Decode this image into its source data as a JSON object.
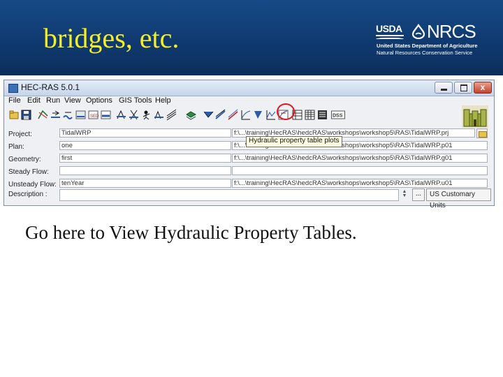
{
  "slide": {
    "title": "bridges, etc.",
    "caption": "Go here to View Hydraulic Property Tables."
  },
  "logo": {
    "usda": "USDA",
    "nrcs": "NRCS",
    "line1": "United States Department of Agriculture",
    "line2": "Natural Resources Conservation Service"
  },
  "window": {
    "title": "HEC-RAS 5.0.1",
    "close_glyph": "x"
  },
  "menu": [
    "File",
    "Edit",
    "Run",
    "View",
    "Options",
    "GIS Tools",
    "Help"
  ],
  "tooltip": "Hydraulic property table plots",
  "rows": {
    "project": {
      "label": "Project:",
      "name": "TidalWRP",
      "path": "f:\\...\\training\\HecRAS\\hedcRAS\\workshops\\workshop5\\RAS\\TidalWRP.prj"
    },
    "plan": {
      "label": "Plan:",
      "name": "one",
      "path": "f:\\...\\training\\HecRAS\\hedcRAS\\workshops\\workshop5\\RAS\\TidalWRP.p01"
    },
    "geometry": {
      "label": "Geometry:",
      "name": "first",
      "path": "f:\\...\\training\\HecRAS\\hedcRAS\\workshops\\workshop5\\RAS\\TidalWRP.g01"
    },
    "steady": {
      "label": "Steady Flow:",
      "name": "",
      "path": ""
    },
    "unsteady": {
      "label": "Unsteady Flow:",
      "name": "tenYear",
      "path": "f:\\...\\training\\HecRAS\\hedcRAS\\workshops\\workshop5\\RAS\\TidalWRP.u01"
    },
    "description": {
      "label": "Description :",
      "value": ""
    }
  },
  "more_button": "...",
  "units": "US Customary Units",
  "colors": {
    "header_blue": "#0f3a70",
    "title_yellow": "#f5ec2c",
    "highlight_red": "#e0161c"
  }
}
